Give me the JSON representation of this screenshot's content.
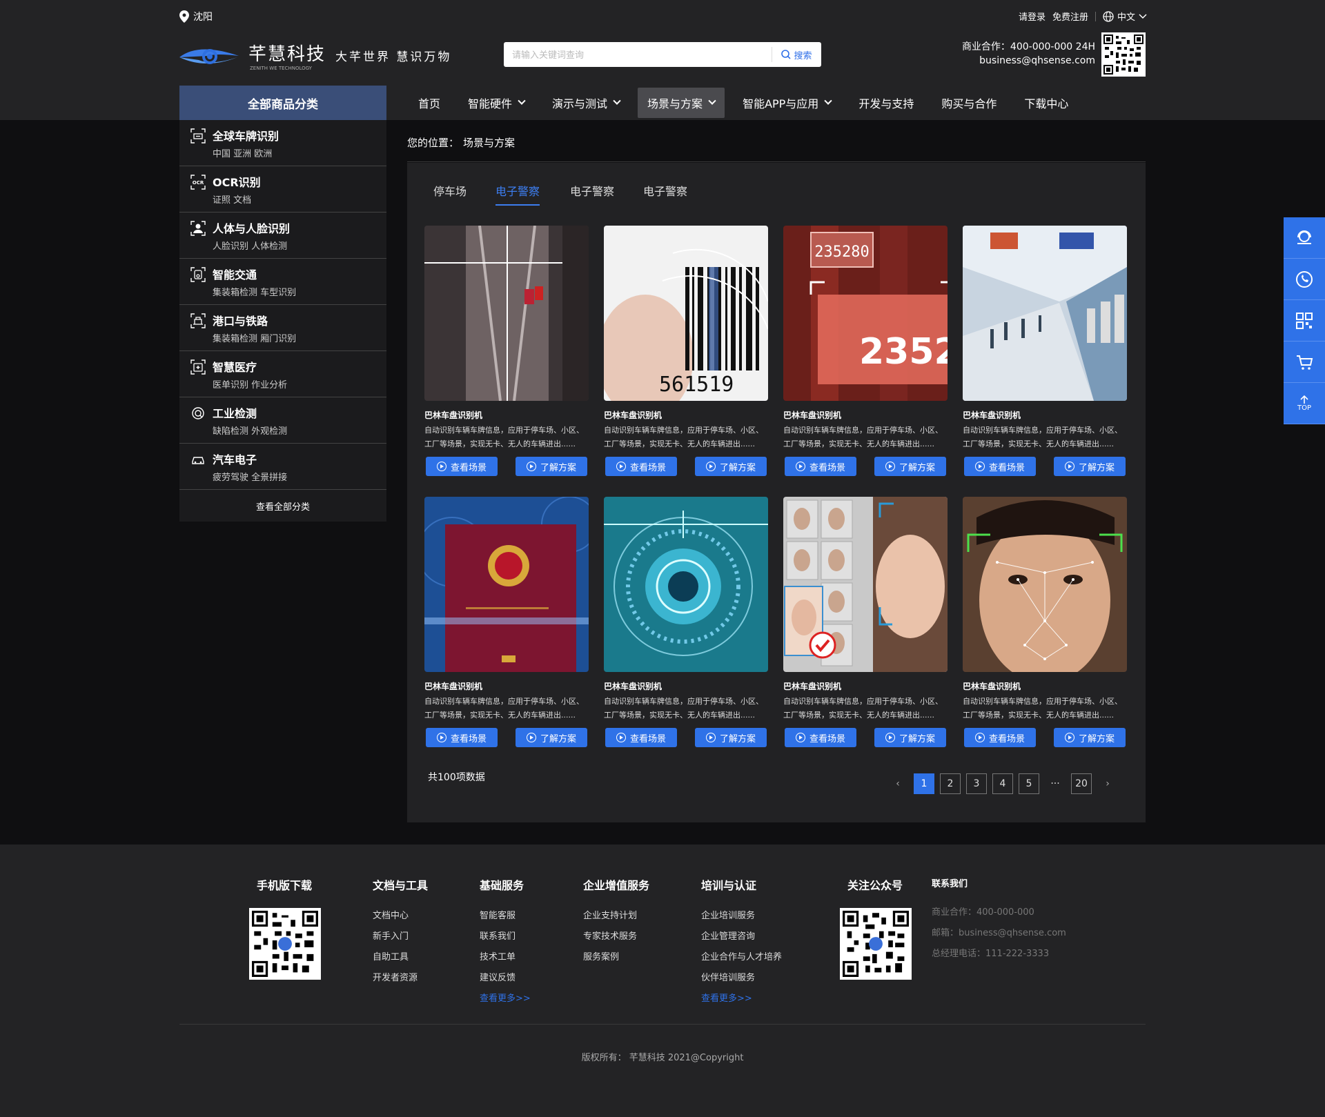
{
  "header": {
    "location": "沈阳",
    "login": "请登录",
    "register": "免费注册",
    "language": "中文",
    "logo_name": "芊慧科技",
    "logo_sub": "ZENITH WE TECHNOLOGY",
    "slogan": "大芊世界 慧识万物",
    "search_placeholder": "请输入关键词查询",
    "search_button": "搜索",
    "biz_phone": "商业合作：400-000-000 24H",
    "biz_email": "business@qhsense.com"
  },
  "nav": {
    "category_title": "全部商品分类",
    "items": [
      {
        "label": "首页"
      },
      {
        "label": "智能硬件"
      },
      {
        "label": "演示与测试"
      },
      {
        "label": "场景与方案"
      },
      {
        "label": "智能APP与应用"
      },
      {
        "label": "开发与支持"
      },
      {
        "label": "购买与合作"
      },
      {
        "label": "下载中心"
      }
    ]
  },
  "sidebar": {
    "items": [
      {
        "title": "全球车牌识别",
        "sub": "中国  亚洲  欧洲",
        "icon": "plate-icon"
      },
      {
        "title": "OCR识别",
        "sub": "证照  文档",
        "icon": "ocr-icon"
      },
      {
        "title": "人体与人脸识别",
        "sub": "人脸识别  人体检测",
        "icon": "face-icon"
      },
      {
        "title": "智能交通",
        "sub": "集装箱检测  车型识别",
        "icon": "traffic-icon"
      },
      {
        "title": "港口与铁路",
        "sub": "集装箱检测  厢门识别",
        "icon": "port-icon"
      },
      {
        "title": "智慧医疗",
        "sub": "医单识别  作业分析",
        "icon": "medical-icon"
      },
      {
        "title": "工业检测",
        "sub": "缺陷检测  外观检测",
        "icon": "industry-icon"
      },
      {
        "title": "汽车电子",
        "sub": "疲劳驾驶  全景拼接",
        "icon": "car-icon"
      }
    ],
    "all_label": "查看全部分类"
  },
  "breadcrumb": {
    "prefix": "您的位置：",
    "current": "场景与方案"
  },
  "tabs": [
    {
      "label": "停车场"
    },
    {
      "label": "电子警察"
    },
    {
      "label": "电子警察"
    },
    {
      "label": "电子警察"
    }
  ],
  "cards": [
    {
      "title": "巴林车盘识别机",
      "desc": "自动识别车辆车牌信息，应用于停车场、小区、工厂等场景，实现无卡、无人的车辆进出......",
      "btn1": "查看场景",
      "btn2": "了解方案"
    },
    {
      "title": "巴林车盘识别机",
      "desc": "自动识别车辆车牌信息，应用于停车场、小区、工厂等场景，实现无卡、无人的车辆进出......",
      "btn1": "查看场景",
      "btn2": "了解方案"
    },
    {
      "title": "巴林车盘识别机",
      "desc": "自动识别车辆车牌信息，应用于停车场、小区、工厂等场景，实现无卡、无人的车辆进出......",
      "btn1": "查看场景",
      "btn2": "了解方案"
    },
    {
      "title": "巴林车盘识别机",
      "desc": "自动识别车辆车牌信息，应用于停车场、小区、工厂等场景，实现无卡、无人的车辆进出......",
      "btn1": "查看场景",
      "btn2": "了解方案"
    },
    {
      "title": "巴林车盘识别机",
      "desc": "自动识别车辆车牌信息，应用于停车场、小区、工厂等场景，实现无卡、无人的车辆进出......",
      "btn1": "查看场景",
      "btn2": "了解方案"
    },
    {
      "title": "巴林车盘识别机",
      "desc": "自动识别车辆车牌信息，应用于停车场、小区、工厂等场景，实现无卡、无人的车辆进出......",
      "btn1": "查看场景",
      "btn2": "了解方案"
    },
    {
      "title": "巴林车盘识别机",
      "desc": "自动识别车辆车牌信息，应用于停车场、小区、工厂等场景，实现无卡、无人的车辆进出......",
      "btn1": "查看场景",
      "btn2": "了解方案"
    },
    {
      "title": "巴林车盘识别机",
      "desc": "自动识别车辆车牌信息，应用于停车场、小区、工厂等场景，实现无卡、无人的车辆进出......",
      "btn1": "查看场景",
      "btn2": "了解方案"
    }
  ],
  "card_image_texts": [
    "235280",
    "561519",
    "235280"
  ],
  "pagination": {
    "total": "共100项数据",
    "pages": [
      "1",
      "2",
      "3",
      "4",
      "5"
    ],
    "dots": "···",
    "last": "20",
    "prev": "‹",
    "next": "›"
  },
  "float_top": "TOP",
  "footer": {
    "cols": [
      {
        "title": "手机版下载"
      },
      {
        "title": "文档与工具",
        "links": [
          "文档中心",
          "新手入门",
          "自助工具",
          "开发者资源"
        ]
      },
      {
        "title": "基础服务",
        "links": [
          "智能客服",
          "联系我们",
          "技术工单",
          "建议反馈"
        ],
        "more": "查看更多>>"
      },
      {
        "title": "企业增值服务",
        "links": [
          "企业支持计划",
          "专家技术服务",
          "服务案例"
        ]
      },
      {
        "title": "培训与认证",
        "links": [
          "企业培训服务",
          "企业管理咨询",
          "企业合作与人才培养",
          "伙伴培训服务"
        ],
        "more": "查看更多>>"
      },
      {
        "title": "关注公众号"
      },
      {
        "title": "联系我们",
        "lines": [
          "商业合作：400-000-000",
          "邮箱：business@qhsense.com",
          "总经理电话：111-222-3333"
        ]
      }
    ],
    "copyright": "版权所有： 芊慧科技 2021@Copyright"
  },
  "colors": {
    "accent": "#2f72e8",
    "header_bg": "#232325",
    "body_bg": "#0f0f11",
    "category_bg": "#3a4e78"
  }
}
